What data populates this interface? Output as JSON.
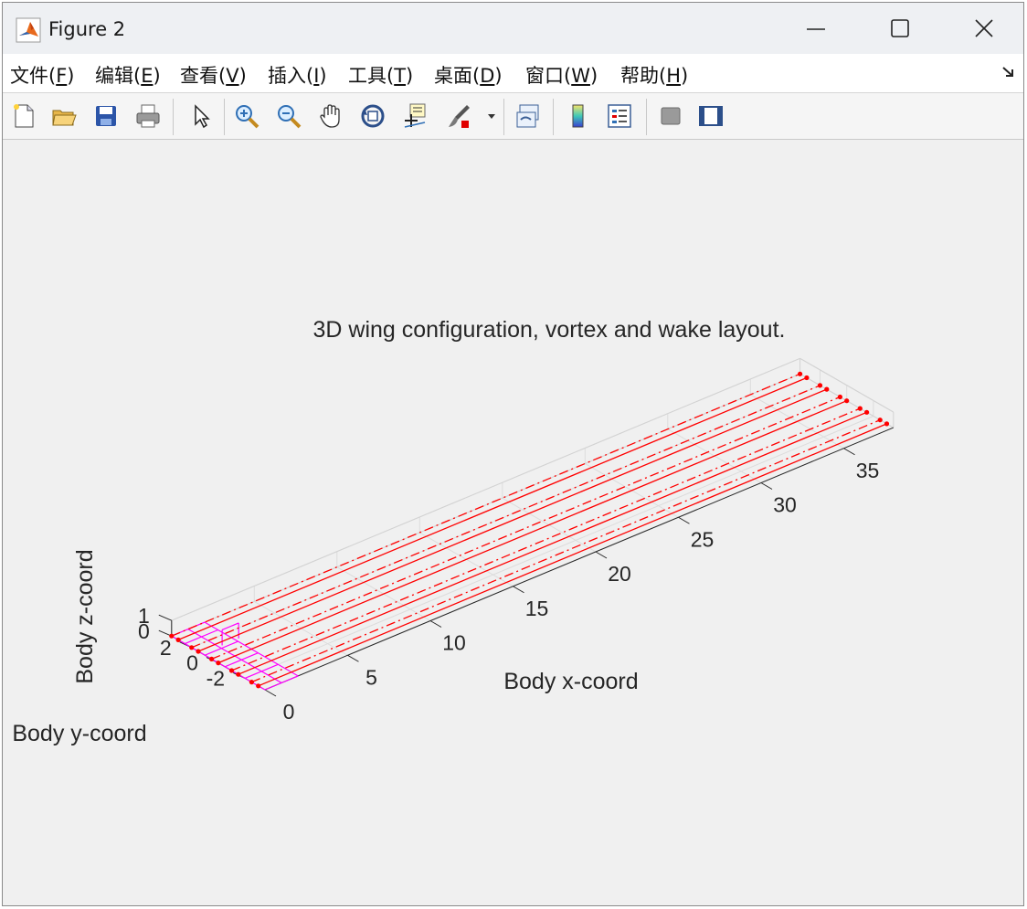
{
  "window": {
    "title": "Figure 2"
  },
  "menu": [
    {
      "label": "文件(",
      "key": "F",
      "end": ")"
    },
    {
      "label": "编辑(",
      "key": "E",
      "end": ")"
    },
    {
      "label": "查看(",
      "key": "V",
      "end": ")"
    },
    {
      "label": "插入(",
      "key": "I",
      "end": ")"
    },
    {
      "label": "工具(",
      "key": "T",
      "end": ")"
    },
    {
      "label": "桌面(",
      "key": "D",
      "end": ")"
    },
    {
      "label": "窗口(",
      "key": "W",
      "end": ")"
    },
    {
      "label": "帮助(",
      "key": "H",
      "end": ")"
    }
  ],
  "toolbar": {
    "buttons": [
      "new-figure-icon",
      "open-file-icon",
      "save-icon",
      "print-icon",
      "pointer-icon",
      "zoom-in-icon",
      "zoom-out-icon",
      "pan-hand-icon",
      "rotate-3d-icon",
      "data-cursor-icon",
      "brush-icon",
      "link-plot-icon",
      "colorbar-icon",
      "legend-icon",
      "hide-plot-tools-icon",
      "show-plot-tools-icon"
    ]
  },
  "chart_data": {
    "type": "line",
    "title": "3D wing configuration, vortex and wake layout.",
    "xlabel": "Body x-coord",
    "ylabel": "Body y-coord",
    "zlabel": "Body z-coord",
    "x_ticks": [
      "0",
      "5",
      "10",
      "15",
      "20",
      "25",
      "30",
      "35"
    ],
    "y_ticks": [
      "2",
      "0",
      "-2"
    ],
    "z_ticks": [
      "1",
      "0"
    ],
    "xlim": [
      0,
      38
    ],
    "ylim": [
      -3.5,
      3.5
    ],
    "zlim": [
      0,
      1
    ],
    "grid": true,
    "colors": {
      "wake": "#ff0000",
      "wing": "#ff00ff",
      "axis": "#262626",
      "grid": "#dcdcdc"
    },
    "series": [
      {
        "style": "solid",
        "x": [
          0,
          38
        ],
        "y": [
          -3.0,
          -3.0
        ]
      },
      {
        "style": "dashdot",
        "x": [
          0,
          38
        ],
        "y": [
          -2.5,
          -2.5
        ]
      },
      {
        "style": "solid",
        "x": [
          0,
          38
        ],
        "y": [
          -1.5,
          -1.5
        ]
      },
      {
        "style": "dashdot",
        "x": [
          0,
          38
        ],
        "y": [
          -1.0,
          -1.0
        ]
      },
      {
        "style": "solid",
        "x": [
          0,
          38
        ],
        "y": [
          0.0,
          0.0
        ]
      },
      {
        "style": "dashdot",
        "x": [
          0,
          38
        ],
        "y": [
          0.5,
          0.5
        ]
      },
      {
        "style": "solid",
        "x": [
          0,
          38
        ],
        "y": [
          1.5,
          1.5
        ]
      },
      {
        "style": "dashdot",
        "x": [
          0,
          38
        ],
        "y": [
          2.0,
          2.0
        ]
      },
      {
        "style": "solid",
        "x": [
          0,
          38
        ],
        "y": [
          3.0,
          3.0
        ]
      },
      {
        "style": "dashdot",
        "x": [
          0,
          38
        ],
        "y": [
          3.5,
          3.5
        ]
      }
    ],
    "wing_panels": {
      "x": [
        0,
        1,
        2
      ],
      "y": [
        -3.5,
        -2,
        -0.5,
        1,
        2.5,
        3.5
      ]
    }
  }
}
